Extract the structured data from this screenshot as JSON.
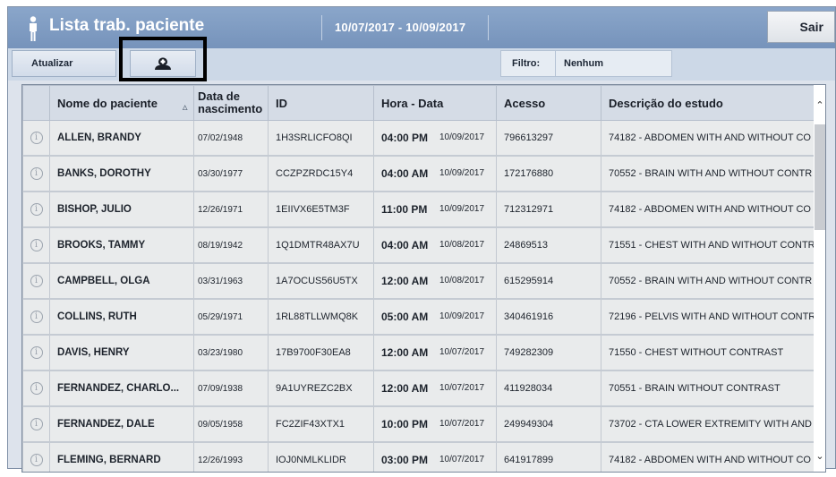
{
  "header": {
    "title": "Lista trab. paciente",
    "date_range": "10/07/2017 - 10/09/2017",
    "exit_label": "Sair"
  },
  "toolbar": {
    "refresh_label": "Atualizar",
    "patient_icon": "patient-icon",
    "filter_label": "Filtro:",
    "filter_value": "Nenhum"
  },
  "table": {
    "columns": {
      "name": "Nome do paciente",
      "dob_line1": "Data de",
      "dob_line2": "nascimento",
      "id": "ID",
      "time": "Hora - Data",
      "access": "Acesso",
      "desc": "Descrição do estudo"
    },
    "rows": [
      {
        "name": "ALLEN, BRANDY",
        "dob": "07/02/1948",
        "id": "1H3SRLICFO8QI",
        "time": "04:00 PM",
        "date": "10/09/2017",
        "access": "796613297",
        "desc": "74182 - ABDOMEN WITH AND WITHOUT CO"
      },
      {
        "name": "BANKS, DOROTHY",
        "dob": "03/30/1977",
        "id": "CCZPZRDC15Y4",
        "time": "04:00 AM",
        "date": "10/09/2017",
        "access": "172176880",
        "desc": "70552 - BRAIN WITH AND WITHOUT CONTR"
      },
      {
        "name": "BISHOP, JULIO",
        "dob": "12/26/1971",
        "id": "1EIIVX6E5TM3F",
        "time": "11:00 PM",
        "date": "10/09/2017",
        "access": "712312971",
        "desc": "74182 - ABDOMEN WITH AND WITHOUT CO"
      },
      {
        "name": "BROOKS, TAMMY",
        "dob": "08/19/1942",
        "id": "1Q1DMTR48AX7U",
        "time": "04:00 AM",
        "date": "10/08/2017",
        "access": "24869513",
        "desc": "71551 - CHEST WITH AND WITHOUT CONTR"
      },
      {
        "name": "CAMPBELL, OLGA",
        "dob": "03/31/1963",
        "id": "1A7OCUS56U5TX",
        "time": "12:00 AM",
        "date": "10/08/2017",
        "access": "615295914",
        "desc": "70552 - BRAIN WITH AND WITHOUT CONTR"
      },
      {
        "name": "COLLINS, RUTH",
        "dob": "05/29/1971",
        "id": "1RL88TLLWMQ8K",
        "time": "05:00 AM",
        "date": "10/09/2017",
        "access": "340461916",
        "desc": "72196 - PELVIS WITH AND WITHOUT CONTR"
      },
      {
        "name": "DAVIS, HENRY",
        "dob": "03/23/1980",
        "id": "17B9700F30EA8",
        "time": "12:00 AM",
        "date": "10/07/2017",
        "access": "749282309",
        "desc": "71550 - CHEST WITHOUT CONTRAST"
      },
      {
        "name": "FERNANDEZ, CHARLO...",
        "dob": "07/09/1938",
        "id": "9A1UYREZC2BX",
        "time": "12:00 AM",
        "date": "10/07/2017",
        "access": "411928034",
        "desc": "70551 - BRAIN WITHOUT CONTRAST"
      },
      {
        "name": "FERNANDEZ, DALE",
        "dob": "09/05/1958",
        "id": "FC2ZIF43XTX1",
        "time": "10:00 PM",
        "date": "10/07/2017",
        "access": "249949304",
        "desc": "73702 - CTA LOWER EXTREMITY WITH AND"
      },
      {
        "name": "FLEMING, BERNARD",
        "dob": "12/26/1993",
        "id": "IOJ0NMLKLIDR",
        "time": "03:00 PM",
        "date": "10/07/2017",
        "access": "641917899",
        "desc": "74182 - ABDOMEN WITH AND WITHOUT CO"
      }
    ]
  }
}
